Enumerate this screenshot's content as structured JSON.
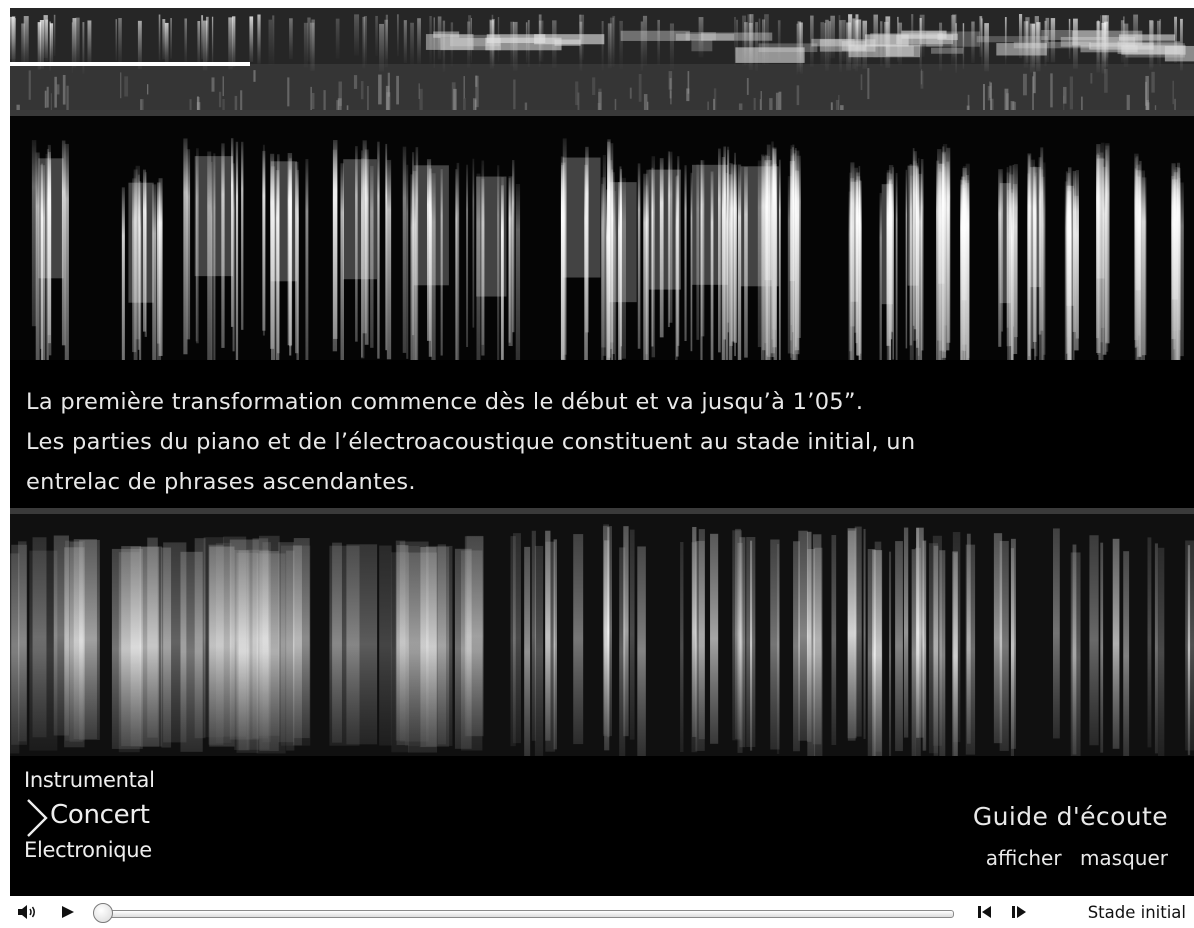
{
  "overview": {
    "progress": 0.203
  },
  "narrative": {
    "line1": "La première transformation commence dès le début et va jusqu’à 1’05”.",
    "line2": "Les parties du piano et de l’électroacoustique constituent au stade initial, un",
    "line3": "entrelac de phrases ascendantes."
  },
  "modes": {
    "instrumental": "Instrumental",
    "concert": "Concert",
    "electronique": "Electronique",
    "selected": "concert"
  },
  "guide": {
    "title": "Guide d'écoute",
    "show": "afficher",
    "hide": "masquer"
  },
  "player": {
    "stage": "Stade initial",
    "position": 0.0,
    "icons": [
      "speaker-icon",
      "play-icon",
      "step-back-icon",
      "step-forward-icon"
    ]
  },
  "colors": {
    "background": "#000000",
    "text": "#e8e8e8",
    "divider": "#3a3a3a"
  }
}
